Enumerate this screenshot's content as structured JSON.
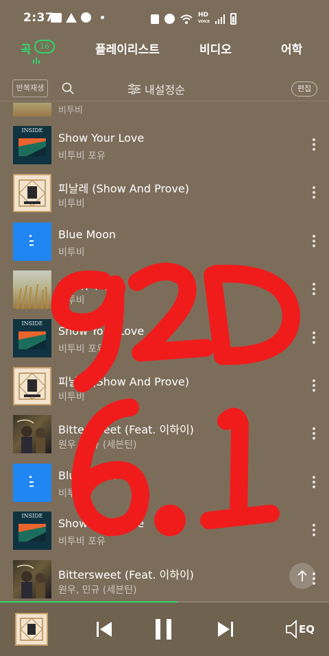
{
  "status_bar": {
    "time": "2:37",
    "hd_label": "HD",
    "volte_label": "VOICE"
  },
  "tabs": [
    {
      "label": "곡",
      "count": "16",
      "active": true
    },
    {
      "label": "플레이리스트"
    },
    {
      "label": "비디오"
    },
    {
      "label": "어학"
    }
  ],
  "toolbar": {
    "repeat_label": "반복재생",
    "sort_label": "내설정순",
    "edit_label": "편집"
  },
  "partial_item": {
    "artist": "비투비"
  },
  "songs": [
    {
      "title": "Show Your Love",
      "artist": "비투비 포유",
      "art": "INSIDE",
      "art_icon": "album-inside"
    },
    {
      "title": "피날레 (Show And Prove)",
      "artist": "비투비",
      "art": "",
      "art_icon": "album-finale"
    },
    {
      "title": "Blue Moon",
      "artist": "비투비",
      "art": "",
      "art_icon": "album-blue-moon"
    },
    {
      "title": "그리워하다",
      "artist": "비투비",
      "art": "",
      "art_icon": "album-wheat"
    },
    {
      "title": "Show Your Love",
      "artist": "비투비 포유",
      "art": "INSIDE",
      "art_icon": "album-inside"
    },
    {
      "title": "피날레 (Show And Prove)",
      "artist": "비투비",
      "art": "",
      "art_icon": "album-finale"
    },
    {
      "title": "Bittersweet (Feat. 이하이)",
      "artist": "원우, 민규 (세븐틴)",
      "art": "",
      "art_icon": "album-bittersweet"
    },
    {
      "title": "Blue Moon",
      "artist": "비투비",
      "art": "",
      "art_icon": "album-blue-moon"
    },
    {
      "title": "Show Your Love",
      "artist": "비투비 포유",
      "art": "INSIDE",
      "art_icon": "album-inside"
    },
    {
      "title": "Bittersweet (Feat. 이하이)",
      "artist": "원우, 민규 (세븐틴)",
      "art": "",
      "art_icon": "album-bittersweet"
    }
  ],
  "player": {
    "progress": 0.54,
    "eq_label": "EQ"
  },
  "overlay_text": {
    "line1": "92D",
    "line2": "6.1"
  },
  "colors": {
    "background": "#7c6d5a",
    "accent": "#2fd66a",
    "overlay_ink": "#f01c1c"
  }
}
